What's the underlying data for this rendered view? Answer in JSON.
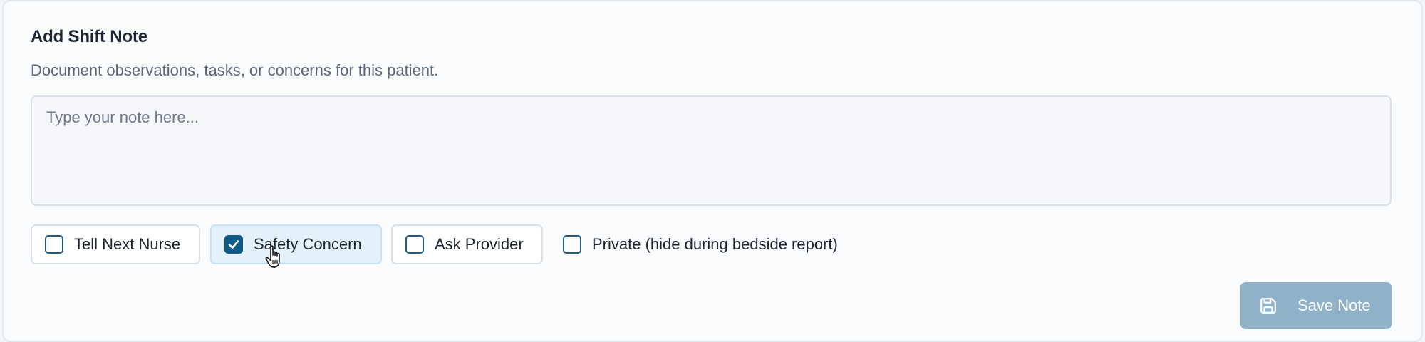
{
  "form": {
    "title": "Add Shift Note",
    "subtitle": "Document observations, tasks, or concerns for this patient.",
    "note_placeholder": "Type your note here...",
    "note_value": ""
  },
  "tags": [
    {
      "label": "Tell Next Nurse",
      "checked": false
    },
    {
      "label": "Safety Concern",
      "checked": true
    },
    {
      "label": "Ask Provider",
      "checked": false
    },
    {
      "label": "Private (hide during bedside report)",
      "checked": false
    }
  ],
  "actions": {
    "save_label": "Save Note",
    "save_icon": "floppy-disk-icon",
    "save_enabled": false
  },
  "colors": {
    "accent": "#0f5a86",
    "checked_chip_bg": "#e3f1fb",
    "save_disabled_bg": "#8fb2c9"
  }
}
